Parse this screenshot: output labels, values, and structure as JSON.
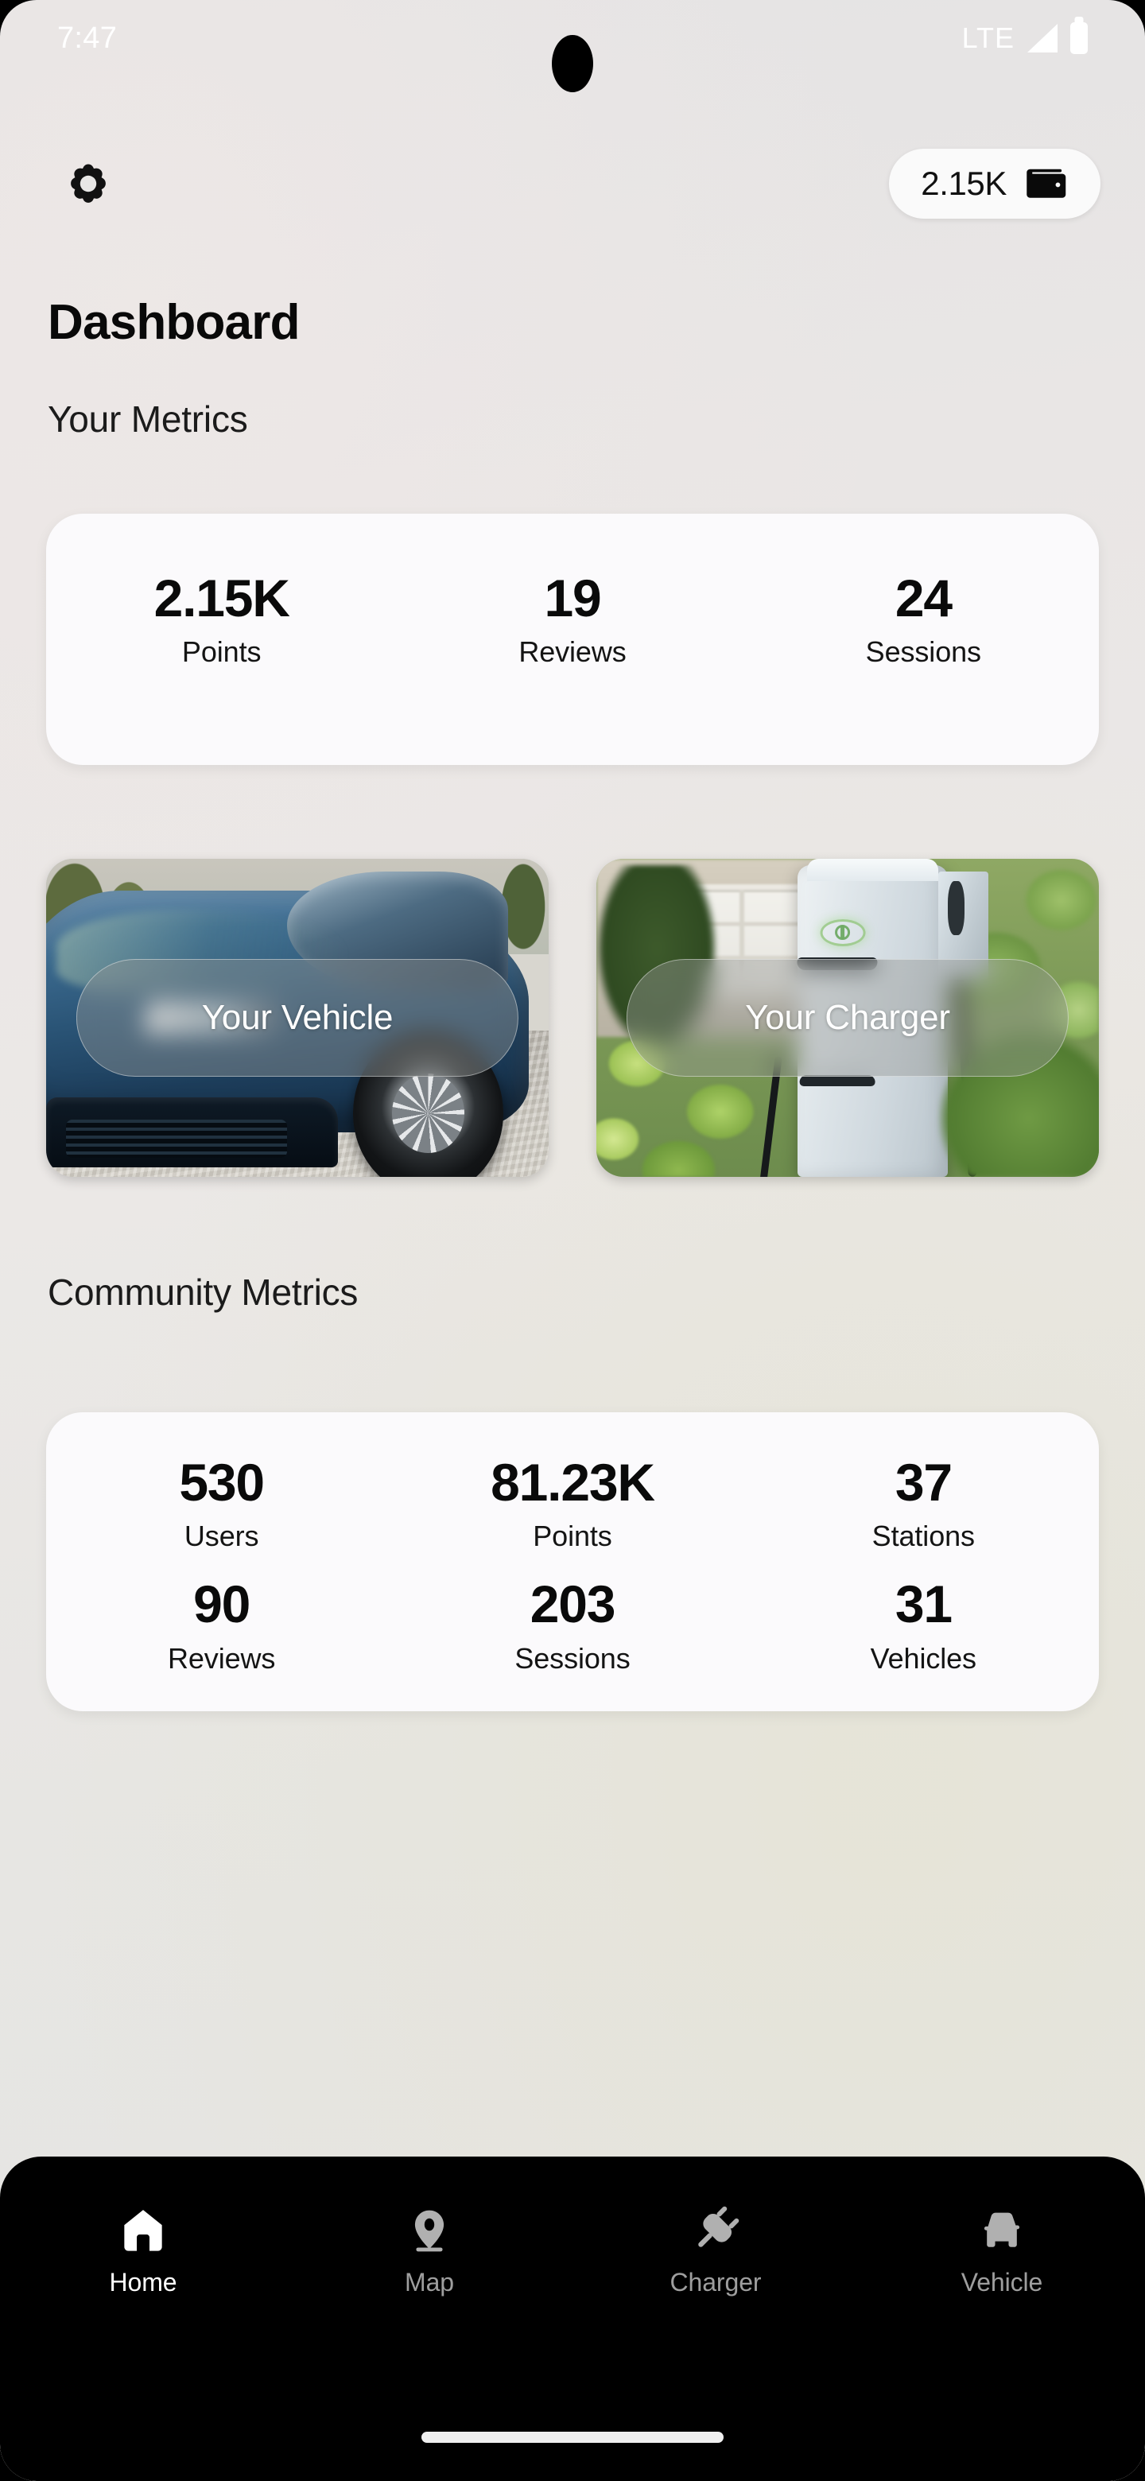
{
  "status_bar": {
    "time": "7:47",
    "network": "LTE",
    "signal_icon": "signal-bars-icon",
    "battery_icon": "battery-icon"
  },
  "header": {
    "settings_icon": "gear-icon",
    "points_pill": {
      "value": "2.15K",
      "icon": "wallet-icon"
    }
  },
  "page": {
    "title": "Dashboard"
  },
  "your_metrics": {
    "heading": "Your Metrics",
    "items": [
      {
        "value": "2.15K",
        "label": "Points"
      },
      {
        "value": "19",
        "label": "Reviews"
      },
      {
        "value": "24",
        "label": "Sessions"
      }
    ]
  },
  "tiles": [
    {
      "label": "Your Vehicle",
      "art": "electric-car-photo"
    },
    {
      "label": "Your Charger",
      "art": "ev-charging-station-photo"
    }
  ],
  "community_metrics": {
    "heading": "Community Metrics",
    "row1": [
      {
        "value": "530",
        "label": "Users"
      },
      {
        "value": "81.23K",
        "label": "Points"
      },
      {
        "value": "37",
        "label": "Stations"
      }
    ],
    "row2": [
      {
        "value": "90",
        "label": "Reviews"
      },
      {
        "value": "203",
        "label": "Sessions"
      },
      {
        "value": "31",
        "label": "Vehicles"
      }
    ]
  },
  "bottom_nav": {
    "items": [
      {
        "label": "Home",
        "icon": "home-icon",
        "active": true
      },
      {
        "label": "Map",
        "icon": "map-pin-icon",
        "active": false
      },
      {
        "label": "Charger",
        "icon": "power-plug-icon",
        "active": false
      },
      {
        "label": "Vehicle",
        "icon": "car-icon",
        "active": false
      }
    ]
  },
  "colors": {
    "background_start": "#e4e3e4",
    "background_end": "#e9e8e6",
    "card_background": "#fbfafc",
    "pill_background": "#fafafa",
    "nav_background": "#000000",
    "nav_active": "#ffffff",
    "nav_inactive": "#9e9e9e",
    "text_primary": "#0a0a0a"
  }
}
